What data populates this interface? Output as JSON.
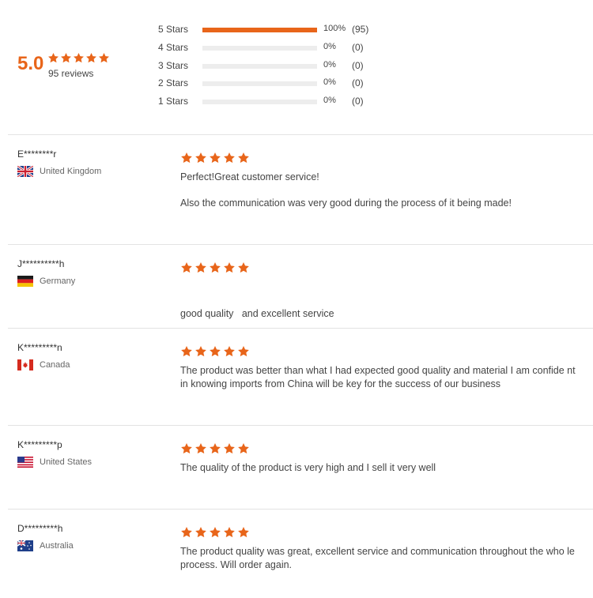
{
  "summary": {
    "average": "5.0",
    "rating_stars": 5,
    "review_count_label": "95 reviews",
    "accent_color": "#e8651a",
    "breakdown": [
      {
        "label": "5 Stars",
        "fraction": 1.0,
        "percent_label": "100%",
        "count_label": "(95)"
      },
      {
        "label": "4 Stars",
        "fraction": 0.0,
        "percent_label": "0%",
        "count_label": "(0)"
      },
      {
        "label": "3 Stars",
        "fraction": 0.0,
        "percent_label": "0%",
        "count_label": "(0)"
      },
      {
        "label": "2 Stars",
        "fraction": 0.0,
        "percent_label": "0%",
        "count_label": "(0)"
      },
      {
        "label": "1 Stars",
        "fraction": 0.0,
        "percent_label": "0%",
        "count_label": "(0)"
      }
    ]
  },
  "reviews": [
    {
      "name": "E********r",
      "country": "United Kingdom",
      "flag_icon": "uk-flag-icon",
      "stars": 5,
      "text": [
        "Perfect!Great customer service!",
        "Also the communication was very good during the process of it being made!"
      ]
    },
    {
      "name": "J**********h",
      "country": "Germany",
      "flag_icon": "germany-flag-icon",
      "stars": 5,
      "text": [
        "good quality   and excellent service"
      ]
    },
    {
      "name": "K*********n",
      "country": "Canada",
      "flag_icon": "canada-flag-icon",
      "stars": 5,
      "text": [
        "The product was better than what I had expected good quality and material I am confide nt in knowing imports from China will be key for the success of our business"
      ]
    },
    {
      "name": "K*********p",
      "country": "United States",
      "flag_icon": "usa-flag-icon",
      "stars": 5,
      "text": [
        "The quality of the product is very high and I sell it very well"
      ]
    },
    {
      "name": "D*********h",
      "country": "Australia",
      "flag_icon": "australia-flag-icon",
      "stars": 5,
      "text": [
        "The product quality was great, excellent service and communication throughout the who le process. Will order again."
      ]
    }
  ]
}
